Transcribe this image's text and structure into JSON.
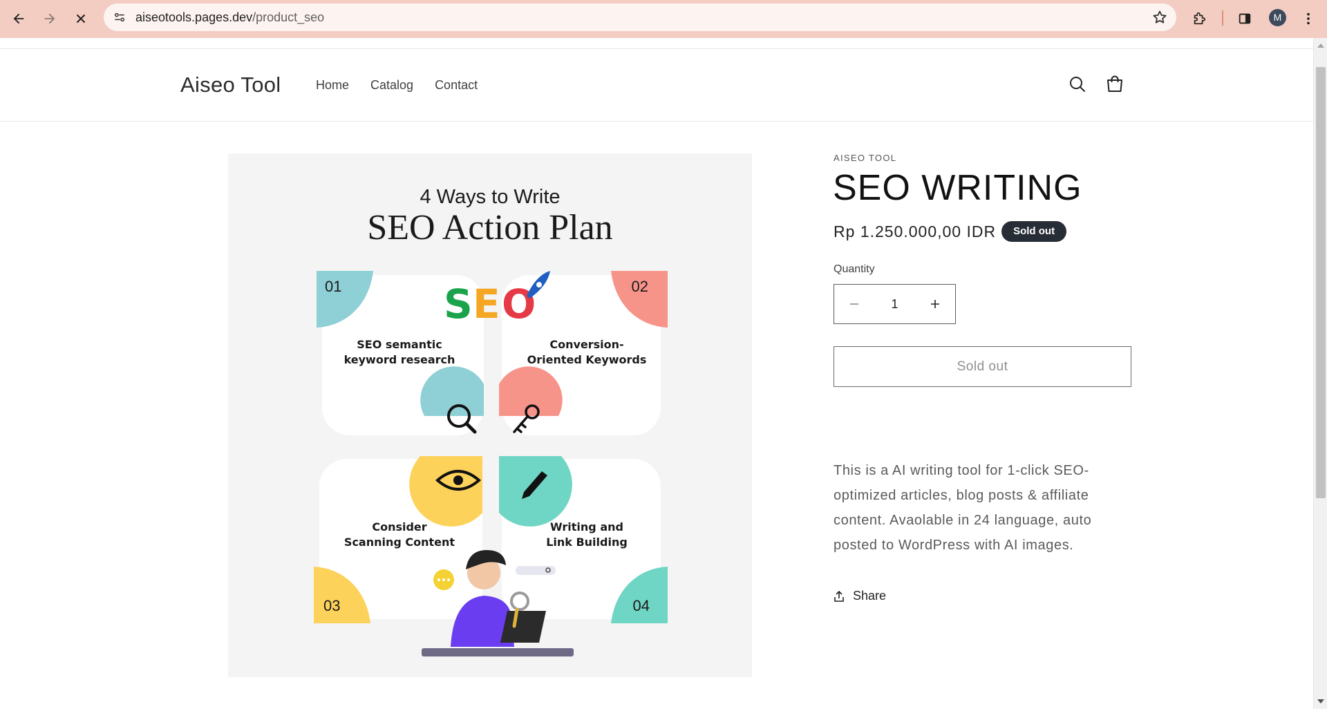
{
  "browser": {
    "url_host": "aiseotools.pages.dev",
    "url_path": "/product_seo",
    "profile_initial": "M",
    "icons": [
      "back-icon",
      "forward-icon",
      "stop-icon",
      "site-settings-icon",
      "star-icon",
      "extensions-icon",
      "side-panel-icon",
      "menu-icon"
    ]
  },
  "header": {
    "logo": "Aiseo Tool",
    "nav": [
      "Home",
      "Catalog",
      "Contact"
    ],
    "icons": [
      "search-icon",
      "cart-icon"
    ]
  },
  "product": {
    "vendor": "AISEO TOOL",
    "title": "SEO WRITING",
    "price": "Rp 1.250.000,00 IDR",
    "badge": "Sold out",
    "quantity_label": "Quantity",
    "quantity": "1",
    "button_label": "Sold out",
    "description": "This is a AI writing tool for 1-click SEO-optimized articles, blog posts & affiliate content. Avaolable in 24 language, auto posted to WordPress with AI images.",
    "share_label": "Share"
  },
  "image": {
    "heading_small": "4 Ways to Write",
    "heading_big": "SEO Action Plan",
    "logo_letters": [
      "S",
      "E",
      "O"
    ],
    "steps": [
      {
        "num": "01",
        "line1": "SEO semantic",
        "line2": "keyword  research",
        "color": "#8fcfd6"
      },
      {
        "num": "02",
        "line1": "Conversion-",
        "line2": "Oriented Keywords",
        "color": "#f7948a"
      },
      {
        "num": "03",
        "line1": "Consider",
        "line2": "Scanning Content",
        "color": "#fdd25a"
      },
      {
        "num": "04",
        "line1": "Writing and",
        "line2": "Link Building",
        "color": "#6fd5c4"
      }
    ],
    "icons": [
      "magnifier-icon",
      "key-icon",
      "eye-icon",
      "pen-icon",
      "rocket-icon"
    ]
  },
  "colors": {
    "chrome": "#f3cdc2",
    "badge": "#272d36",
    "seo_green": "#1aa34a",
    "seo_orange": "#f5a623",
    "seo_red": "#e63946"
  }
}
